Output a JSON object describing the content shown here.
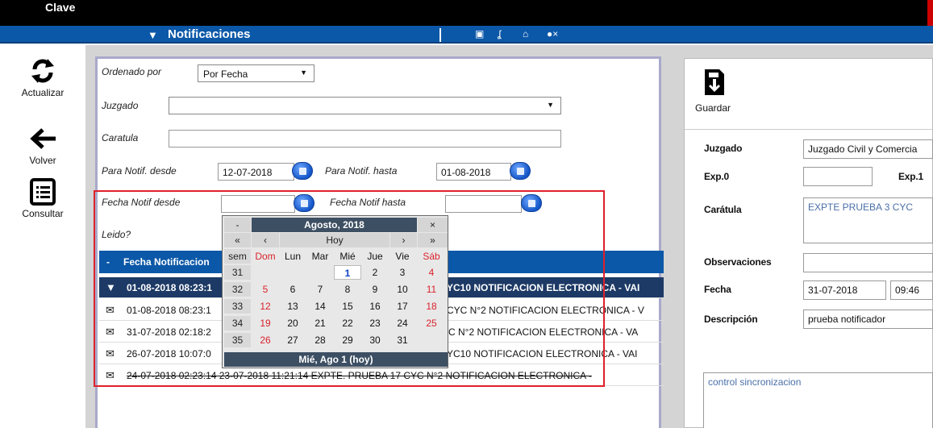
{
  "app": {
    "title": "Clave"
  },
  "navbar": {
    "title": "Notificaciones",
    "icons": [
      "notification-icon",
      "document-icon",
      "sync-icon",
      "home-icon",
      "user-remove-icon"
    ]
  },
  "sidebar": {
    "items": [
      {
        "label": "Actualizar",
        "icon": "refresh-icon"
      },
      {
        "label": "Volver",
        "icon": "back-arrow-icon"
      },
      {
        "label": "Consultar",
        "icon": "list-icon"
      }
    ]
  },
  "filters": {
    "ordenado_label": "Ordenado por",
    "ordenado_value": "Por Fecha",
    "juzgado_label": "Juzgado",
    "juzgado_value": "",
    "caratula_label": "Caratula",
    "caratula_value": "",
    "para_desde_label": "Para Notif. desde",
    "para_desde_value": "12-07-2018",
    "para_hasta_label": "Para Notif. hasta",
    "para_hasta_value": "01-08-2018",
    "fecha_desde_label": "Fecha Notif desde",
    "fecha_desde_value": "",
    "fecha_hasta_label": "Fecha Notif hasta",
    "fecha_hasta_value": "",
    "leido_label": "Leido?"
  },
  "grid": {
    "header": {
      "col0": "-",
      "col1": "Fecha Notificacion"
    },
    "rows": [
      {
        "text": "01-08-2018 08:23:1",
        "desc": "YC10 NOTIFICACION ELECTRONICA - VAI"
      },
      {
        "text": "01-08-2018 08:23:1",
        "desc": "CYC N°2 NOTIFICACION ELECTRONICA - V"
      },
      {
        "text": "31-07-2018 02:18:2",
        "desc": "C N°2 NOTIFICACION ELECTRONICA - VA"
      },
      {
        "text": "26-07-2018 10:07:0",
        "desc": "YC10 NOTIFICACION ELECTRONICA - VAI"
      },
      {
        "text": "24-07-2018 02:23:14   23-07-2018 11:21:14   EXPTE. PRUEBA 17 CYC N°2 NOTIFICACION ELECTRONICA -",
        "desc": ""
      }
    ]
  },
  "calendar": {
    "month_title": "Agosto, 2018",
    "prev_year": "«",
    "prev_month": "‹",
    "today_label": "Hoy",
    "next_month": "›",
    "next_year": "»",
    "close_label": "×",
    "menu_label": "-",
    "week_header": "sem",
    "day_headers": [
      "Dom",
      "Lun",
      "Mar",
      "Mié",
      "Jue",
      "Vie",
      "Sáb"
    ],
    "weeks": [
      {
        "wk": "31",
        "days": [
          "",
          "",
          "",
          "1",
          "2",
          "3",
          "4"
        ]
      },
      {
        "wk": "32",
        "days": [
          "5",
          "6",
          "7",
          "8",
          "9",
          "10",
          "11"
        ]
      },
      {
        "wk": "33",
        "days": [
          "12",
          "13",
          "14",
          "15",
          "16",
          "17",
          "18"
        ]
      },
      {
        "wk": "34",
        "days": [
          "19",
          "20",
          "21",
          "22",
          "23",
          "24",
          "25"
        ]
      },
      {
        "wk": "35",
        "days": [
          "26",
          "27",
          "28",
          "29",
          "30",
          "31",
          ""
        ]
      }
    ],
    "footer": "Mié, Ago 1 (hoy)"
  },
  "detail": {
    "save_label": "Guardar",
    "juzgado_label": "Juzgado",
    "juzgado_value": "Juzgado Civil y Comercia",
    "exp0_label": "Exp.0",
    "exp0_value": "",
    "exp1_label": "Exp.1",
    "caratula_label": "Carátula",
    "caratula_value": "EXPTE PRUEBA 3 CYC",
    "observaciones_label": "Observaciones",
    "observaciones_value": "",
    "fecha_label": "Fecha",
    "fecha_value": "31-07-2018",
    "hora_value": "09:46",
    "descripcion_label": "Descripción",
    "descripcion_value": "prueba notificador",
    "texto_value": "control sincronizacion"
  },
  "colors": {
    "navbar": "#0c58a8",
    "highlight_box": "#e0202a",
    "selected_row": "#1d3a66"
  }
}
